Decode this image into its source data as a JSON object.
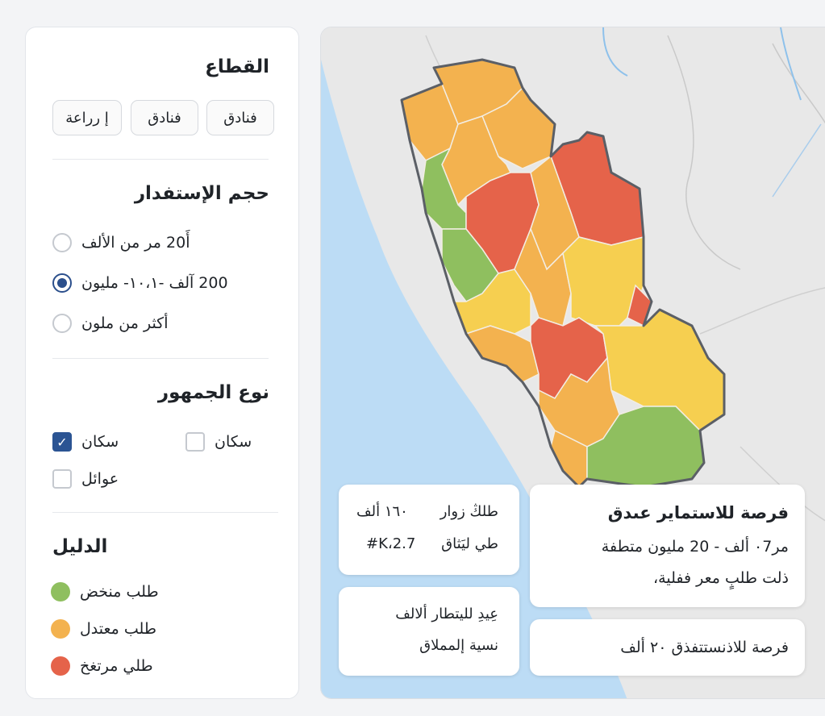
{
  "sidebar": {
    "sector": {
      "title": "القطاع",
      "chips": [
        "فنادق",
        "فنادق",
        "إ رراعة"
      ]
    },
    "volume": {
      "title": "حجم الإستفدار",
      "options": [
        {
          "label": "أَ20 مر من الألف",
          "selected": false
        },
        {
          "label": "200  آلف -١٠،١- مليون",
          "selected": true
        },
        {
          "label": "أكثر من ملون",
          "selected": false
        }
      ]
    },
    "audience": {
      "title": "نوع الجمهور",
      "options": [
        {
          "label": "سكان",
          "checked": false
        },
        {
          "label": "سكان",
          "checked": true
        },
        {
          "label": "عوائل",
          "checked": false
        }
      ]
    },
    "legend": {
      "title": "الدليل",
      "items": [
        {
          "label": "طلب منخض",
          "color": "#8fbf5f"
        },
        {
          "label": "طلب معتدل",
          "color": "#f3b24f"
        },
        {
          "label": "طلي مرتغخ",
          "color": "#e5634a"
        }
      ]
    }
  },
  "map": {
    "colors": {
      "sea": "#bcdcf5",
      "land": "#e8e8e8",
      "low": "#8fbf5f",
      "medium": "#f3b24f",
      "medium_yellow": "#f6cf50",
      "high": "#e5634a",
      "border": "#5b5f66",
      "river": "#8ec1eb"
    },
    "cards": {
      "stats": {
        "row1_label": "طلڭ زوار",
        "row1_value": "١٦٠ ألف",
        "row2_label": "طي ليَثاق",
        "row2_value": "2.7،K#"
      },
      "opportunity": {
        "title": "فرصة للاستماير عىدق",
        "line1": "مر٠7 ألف  -  20 مليون متطفة",
        "line2": "ذلت طلبٍ معر ففلية،"
      },
      "growth": {
        "line1": "عِيدِ لليتطار ألالف",
        "line2": "نسية إلمملاق"
      },
      "bottom": {
        "line1": "فرصة للاذنستتفذق ٢٠ ألف"
      }
    }
  }
}
